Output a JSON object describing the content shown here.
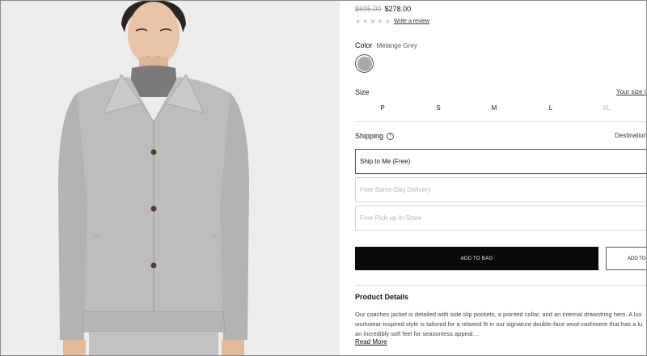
{
  "product": {
    "price_original": "$695.00",
    "price_sale": "$278.00",
    "rating_stars": 0,
    "write_review_label": "Write a review",
    "image_alt_icon": "coach-jacket-photo"
  },
  "color": {
    "label": "Color",
    "selected_name": "Melange Grey",
    "swatch_hex": "#a9a9a9"
  },
  "size": {
    "label": "Size",
    "guide_link": "Your size i",
    "options": [
      {
        "label": "P",
        "available": true
      },
      {
        "label": "S",
        "available": true
      },
      {
        "label": "M",
        "available": true
      },
      {
        "label": "L",
        "available": true
      },
      {
        "label": "XL",
        "available": false
      }
    ]
  },
  "shipping": {
    "label": "Shipping",
    "info_icon": "?",
    "destination_label": "Destination",
    "options": [
      {
        "label": "Ship to Me (Free)",
        "selected": true
      },
      {
        "label": "Free Same-Day Delivery",
        "selected": false
      },
      {
        "label": "Free Pick-up In-Store",
        "selected": false
      }
    ]
  },
  "actions": {
    "add_to_bag": "ADD TO BAG",
    "add_to_wishlist": "ADD TO"
  },
  "product_details": {
    "title": "Product Details",
    "lines": [
      "Our coaches jacket is detailed with side slip pockets, a pointed collar, and an internal drawstring hem. A lux",
      "workwear-inspired style is tailored for a relaxed fit in our signature double-face wool-cashmere that has a lu",
      "an incredibly soft feel for seasonless appeal...."
    ],
    "read_more": "Read More"
  },
  "colors": {
    "accent_black": "#0a0a0a",
    "sale_grey": "#9a9a9a",
    "jacket_grey": "#bdbdbd"
  }
}
